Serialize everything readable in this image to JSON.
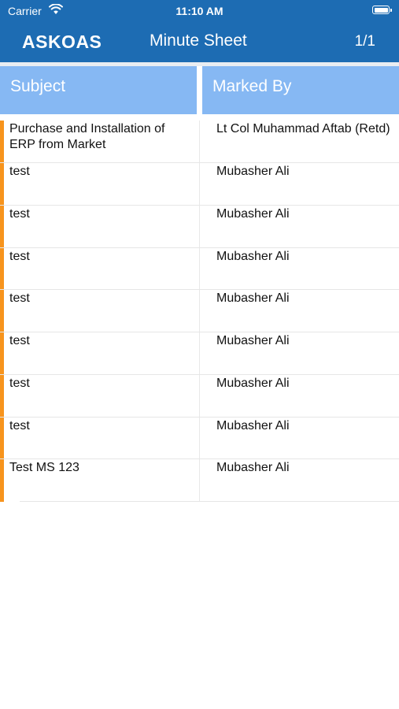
{
  "status_bar": {
    "carrier": "Carrier",
    "time": "11:10 AM"
  },
  "header": {
    "logo": "ASKOAS",
    "title": "Minute Sheet",
    "page_indicator": "1/1"
  },
  "table": {
    "columns": [
      "Subject",
      "Marked By"
    ],
    "rows": [
      {
        "subject": "Purchase and Installation of ERP from Market",
        "marked_by": "Lt Col Muhammad Aftab (Retd)"
      },
      {
        "subject": "test",
        "marked_by": "Mubasher Ali"
      },
      {
        "subject": "test",
        "marked_by": "Mubasher Ali"
      },
      {
        "subject": "test",
        "marked_by": "Mubasher Ali"
      },
      {
        "subject": "test",
        "marked_by": "Mubasher Ali"
      },
      {
        "subject": "test",
        "marked_by": "Mubasher Ali"
      },
      {
        "subject": "test",
        "marked_by": "Mubasher Ali"
      },
      {
        "subject": "test",
        "marked_by": "Mubasher Ali"
      },
      {
        "subject": "Test MS 123",
        "marked_by": "Mubasher Ali"
      }
    ]
  },
  "colors": {
    "header_bg": "#1d6cb3",
    "column_header_bg": "#86b8f3",
    "accent": "#f7941d"
  },
  "icons": [
    "wifi-icon",
    "battery-icon"
  ]
}
